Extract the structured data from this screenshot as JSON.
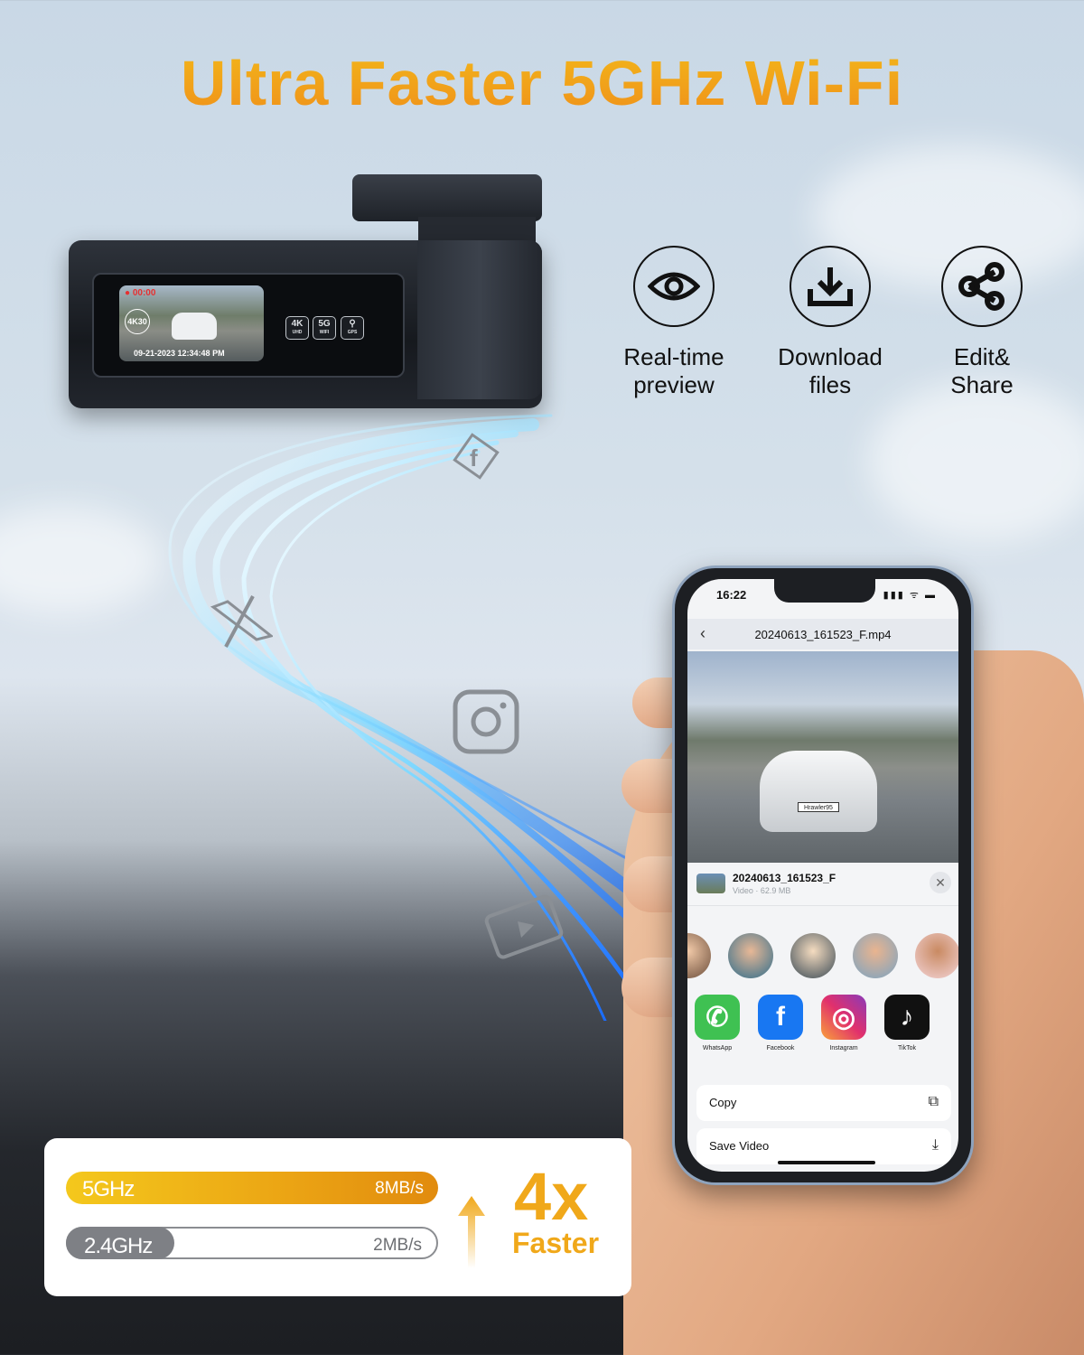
{
  "headline": "Ultra Faster 5GHz Wi-Fi",
  "dashcam": {
    "screen": {
      "recording_time": "● 00:00",
      "resolution_badge": "4K30",
      "timestamp": "09-21-2023 12:34:48 PM"
    },
    "badges": [
      {
        "icon": "4k-icon",
        "top": "4K",
        "bottom": "UHD"
      },
      {
        "icon": "5g-wifi-icon",
        "top": "5G",
        "bottom": "WIFI"
      },
      {
        "icon": "gps-pin-icon",
        "top": "⚲",
        "bottom": "GPS"
      }
    ]
  },
  "features": [
    {
      "icon": "eye-icon",
      "label_line1": "Real-time",
      "label_line2": "preview"
    },
    {
      "icon": "download-icon",
      "label_line1": "Download",
      "label_line2": "files"
    },
    {
      "icon": "share-icon",
      "label_line1": "Edit&",
      "label_line2": "Share"
    }
  ],
  "stream_icons": [
    "facebook-icon",
    "x-icon",
    "instagram-icon",
    "video-play-icon"
  ],
  "phone": {
    "status": {
      "time": "16:22",
      "right": "▮▮▮ ᯤ ▬"
    },
    "nav": {
      "back": "‹",
      "title": "20240613_161523_F.mp4"
    },
    "video": {
      "plate": "Hrawler95"
    },
    "share_sheet": {
      "file_name": "20240613_161523_F",
      "file_meta": "Video · 62.9 MB",
      "close": "✕",
      "contacts_count": 5,
      "apps": [
        {
          "name": "WhatsApp",
          "icon": "whatsapp-icon",
          "glyph": "✆",
          "color": "#3fc152"
        },
        {
          "name": "Facebook",
          "icon": "facebook-icon",
          "glyph": "f",
          "color": "#1877f2"
        },
        {
          "name": "Instagram",
          "icon": "instagram-icon",
          "glyph": "◎",
          "color": "#d6306e"
        },
        {
          "name": "TikTok",
          "icon": "tiktok-icon",
          "glyph": "♪",
          "color": "#111111"
        }
      ],
      "actions": [
        {
          "label": "Copy",
          "icon": "copy-icon",
          "glyph": "⧉"
        },
        {
          "label": "Save Video",
          "icon": "save-icon",
          "glyph": "⤓"
        }
      ]
    }
  },
  "speed_comparison": {
    "bars": [
      {
        "band": "5GHz",
        "speed": "8MB/s",
        "value": 8
      },
      {
        "band": "2.4GHz",
        "speed": "2MB/s",
        "value": 2
      }
    ],
    "multiplier": "4x",
    "multiplier_label": "Faster",
    "accent_color": "#f0a81a"
  }
}
